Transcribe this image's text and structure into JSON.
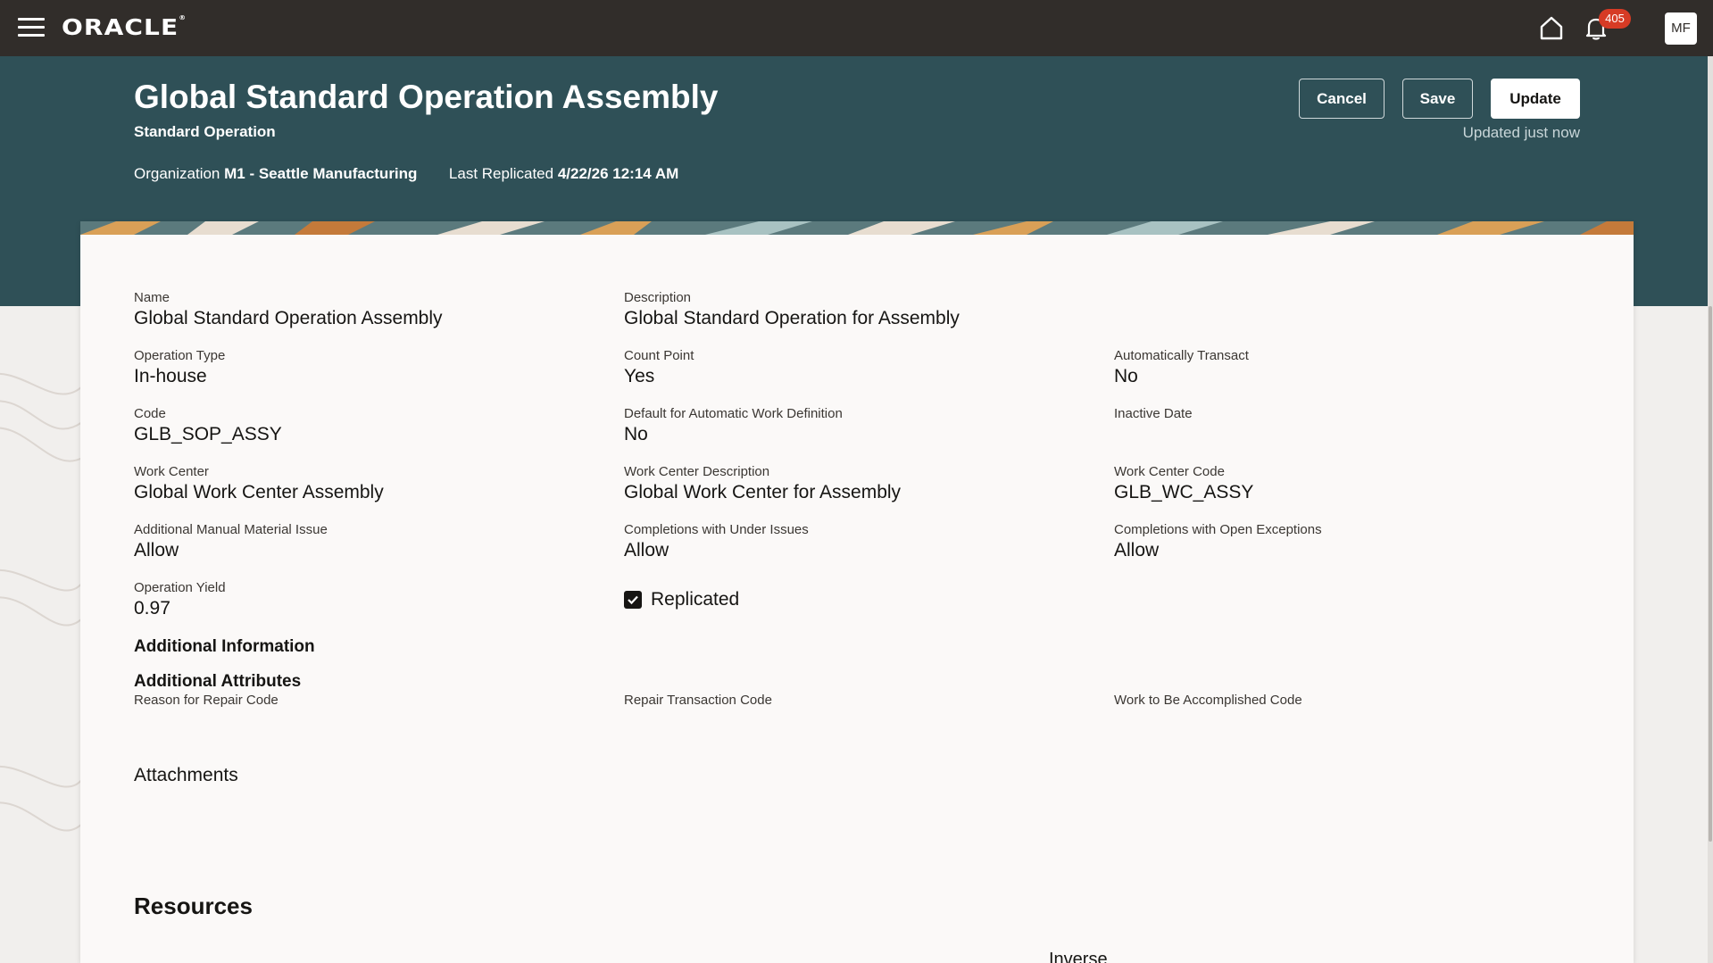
{
  "app": {
    "logo": "ORACLE",
    "notifications_count": "405",
    "user_initials": "MF",
    "icons": [
      "hamburger-menu-icon",
      "home-icon",
      "bell-icon"
    ]
  },
  "header": {
    "title": "Global Standard Operation Assembly",
    "subtitle": "Standard Operation",
    "organization_label": "Organization",
    "organization_value": "M1 - Seattle Manufacturing",
    "replicated_label": "Last Replicated",
    "replicated_value": "4/22/26 12:14 AM",
    "cancel_label": "Cancel",
    "save_label": "Save",
    "update_label": "Update",
    "updated_status": "Updated just now"
  },
  "details": {
    "name": {
      "label": "Name",
      "value": "Global Standard Operation Assembly"
    },
    "description": {
      "label": "Description",
      "value": "Global Standard Operation for Assembly"
    },
    "operation_type": {
      "label": "Operation Type",
      "value": "In-house"
    },
    "count_point": {
      "label": "Count Point",
      "value": "Yes"
    },
    "auto_transact": {
      "label": "Automatically Transact",
      "value": "No"
    },
    "code": {
      "label": "Code",
      "value": "GLB_SOP_ASSY"
    },
    "default_awd": {
      "label": "Default for Automatic Work Definition",
      "value": "No"
    },
    "inactive_date": {
      "label": "Inactive Date",
      "value": ""
    },
    "work_center": {
      "label": "Work Center",
      "value": "Global Work Center Assembly"
    },
    "work_center_desc": {
      "label": "Work Center Description",
      "value": "Global Work Center for Assembly"
    },
    "work_center_code": {
      "label": "Work Center Code",
      "value": "GLB_WC_ASSY"
    },
    "manual_issue": {
      "label": "Additional Manual Material Issue",
      "value": "Allow"
    },
    "under_issues": {
      "label": "Completions with Under Issues",
      "value": "Allow"
    },
    "open_exceptions": {
      "label": "Completions with Open Exceptions",
      "value": "Allow"
    },
    "operation_yield": {
      "label": "Operation Yield",
      "value": "0.97"
    },
    "replicated": {
      "label": "Replicated",
      "checked": true
    }
  },
  "additional": {
    "info_title": "Additional Information",
    "attributes_title": "Additional Attributes",
    "reason_repair": {
      "label": "Reason for Repair Code",
      "value": ""
    },
    "repair_transaction": {
      "label": "Repair Transaction Code",
      "value": ""
    },
    "work_accomplished": {
      "label": "Work to Be Accomplished Code",
      "value": ""
    }
  },
  "attachments": {
    "title": "Attachments"
  },
  "resources": {
    "title": "Resources",
    "visible_column_head": "Inverse"
  },
  "colors": {
    "topbar": "#312d2a",
    "header_band": "#2f5057",
    "card": "#fbf9f8",
    "badge": "#d63b25"
  }
}
